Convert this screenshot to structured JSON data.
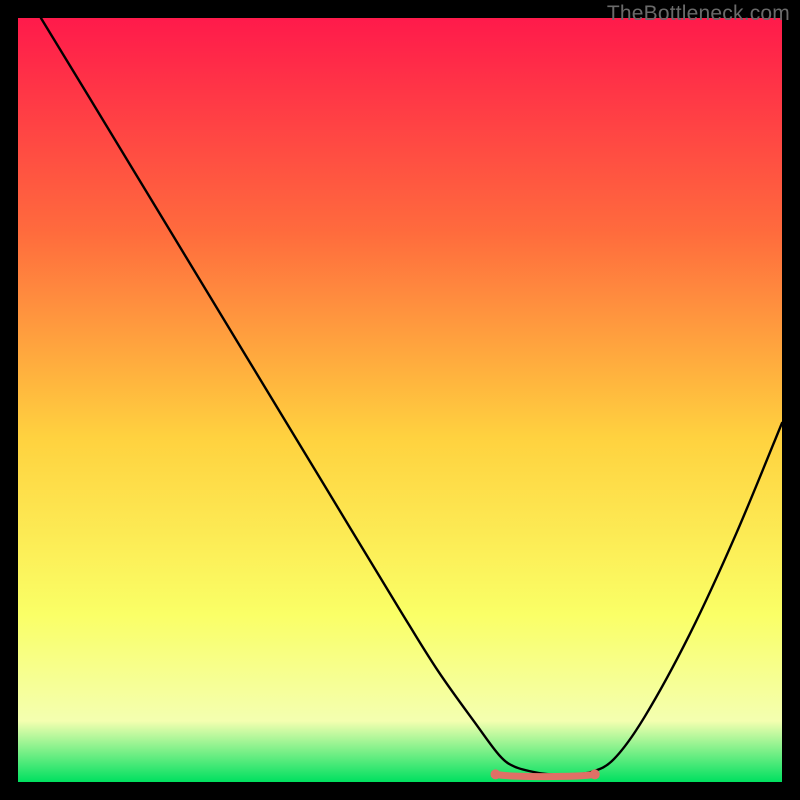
{
  "watermark": "TheBottleneck.com",
  "chart_data": {
    "type": "line",
    "title": "",
    "xlabel": "",
    "ylabel": "",
    "xlim": [
      0,
      100
    ],
    "ylim": [
      0,
      100
    ],
    "grid": false,
    "legend": false,
    "background_gradient_top": "#ff1a4b",
    "background_gradient_mid_upper": "#ff6b3d",
    "background_gradient_mid": "#ffd23f",
    "background_gradient_lower": "#faff66",
    "background_gradient_near_bottom": "#f4ffb0",
    "background_gradient_bottom": "#00e060",
    "black_curve": {
      "description": "V-shaped bottleneck curve: steep descent from top-left, minimum plateau around x≈63–75, rise toward upper-right",
      "x": [
        3.0,
        10,
        20,
        30,
        40,
        50,
        55,
        60,
        63,
        65,
        68,
        70,
        72,
        75,
        78,
        82,
        88,
        94,
        100
      ],
      "y_down": [
        100,
        88.5,
        72,
        55.5,
        39,
        22.5,
        14.5,
        7.5,
        3.5,
        2.0,
        1.2,
        1.0,
        1.0,
        1.3,
        3.0,
        8.5,
        19.5,
        32.5,
        47
      ],
      "note": "y_down is distance from top edge as percent of plot height (0 = top, 100 = bottom). Values estimated from pixel positions."
    },
    "bottom_highlight": {
      "description": "Short salmon-colored segment marking the curve minimum/optimal zone",
      "color": "#e07066",
      "x_start": 62.5,
      "x_end": 75.5,
      "y_down": 1.0,
      "endpoint_radius_pct": 0.65
    }
  }
}
